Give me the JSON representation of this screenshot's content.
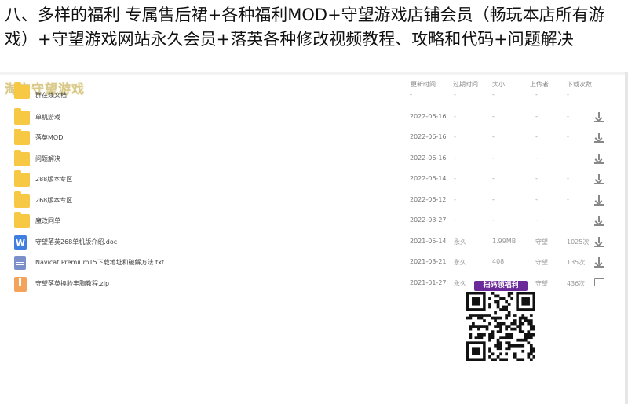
{
  "headline": "八、多样的福利 专属售后裙+各种福利MOD+守望游戏店铺会员（畅玩本店所有游戏）+守望游戏网站永久会员+落英各种修改视频教程、攻略和代码+问题解决",
  "watermark": "淘宝守望游戏",
  "columns": {
    "modified": "更新时间",
    "expire": "过期时间",
    "size": "大小",
    "uploader": "上传者",
    "downloads": "下载次数"
  },
  "rows": [
    {
      "type": "folder",
      "name": "群在线文档",
      "date": "-",
      "expire": "-",
      "size": "-",
      "uploader": "-",
      "downloads": "-",
      "action": "none"
    },
    {
      "type": "folder",
      "name": "单机游戏",
      "date": "2022-06-16",
      "expire": "-",
      "size": "-",
      "uploader": "-",
      "downloads": "-",
      "action": "download"
    },
    {
      "type": "folder",
      "name": "落英MOD",
      "date": "2022-06-16",
      "expire": "-",
      "size": "-",
      "uploader": "-",
      "downloads": "-",
      "action": "download"
    },
    {
      "type": "folder",
      "name": "问题解决",
      "date": "2022-06-16",
      "expire": "-",
      "size": "-",
      "uploader": "-",
      "downloads": "-",
      "action": "download"
    },
    {
      "type": "folder",
      "name": "288版本专区",
      "date": "2022-06-14",
      "expire": "-",
      "size": "-",
      "uploader": "-",
      "downloads": "-",
      "action": "download"
    },
    {
      "type": "folder",
      "name": "268版本专区",
      "date": "2022-06-12",
      "expire": "-",
      "size": "-",
      "uploader": "-",
      "downloads": "-",
      "action": "download"
    },
    {
      "type": "folder",
      "name": "魔改同单",
      "date": "2022-03-27",
      "expire": "-",
      "size": "-",
      "uploader": "-",
      "downloads": "-",
      "action": "download"
    },
    {
      "type": "doc",
      "name": "守望落英268单机版介绍.doc",
      "date": "2021-05-14",
      "expire": "永久",
      "size": "1.99MB",
      "uploader": "守望",
      "downloads": "1025次",
      "action": "download"
    },
    {
      "type": "txt",
      "name": "Navicat Premium15下载地址和破解方法.txt",
      "date": "2021-03-21",
      "expire": "永久",
      "size": "408",
      "uploader": "守望",
      "downloads": "135次",
      "action": "download"
    },
    {
      "type": "zip",
      "name": "守望落英换脸丰胸教程.zip",
      "date": "2021-01-27",
      "expire": "永久",
      "size": "",
      "uploader": "守望",
      "downloads": "436次",
      "action": "folder"
    }
  ],
  "qr_label": "扫码领福利",
  "icons": {
    "folder": "folder-icon",
    "doc": "word-doc-icon",
    "txt": "text-file-icon",
    "zip": "zip-file-icon",
    "download": "download-icon",
    "open": "folder-open-icon"
  },
  "colors": {
    "folder": "#f7c844",
    "doc": "#3f7fe0",
    "qr_label_bg": "#6b2a9a"
  }
}
